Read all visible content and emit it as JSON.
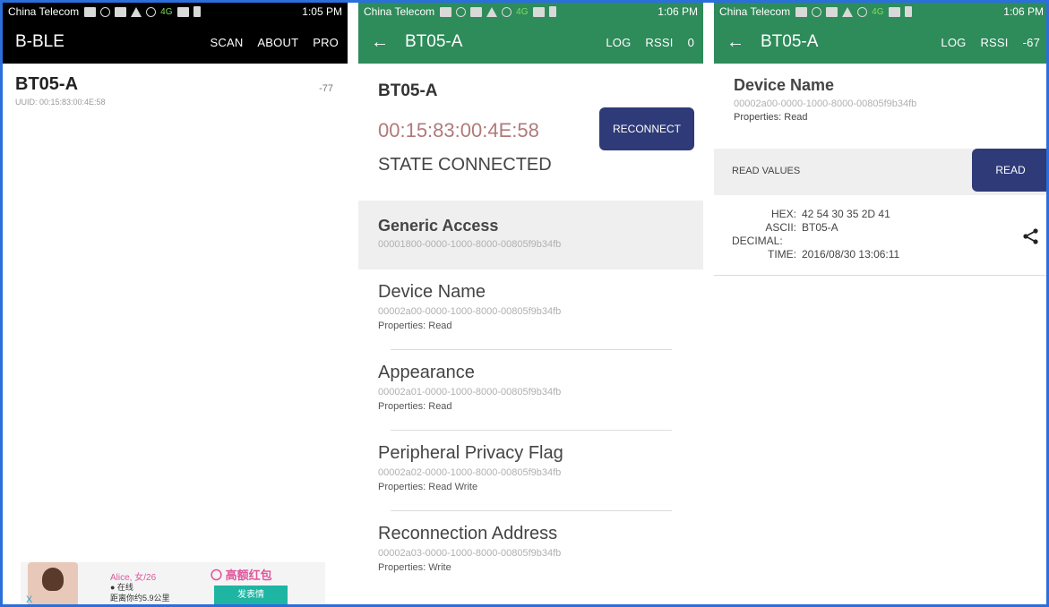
{
  "status_bar": {
    "carrier": "China Telecom",
    "signal_label": "4G",
    "time_1": "1:05 PM",
    "time_2": "1:06 PM",
    "time_3": "1:06 PM"
  },
  "scan_screen": {
    "app_title": "B-BLE",
    "actions": [
      "SCAN",
      "ABOUT",
      "PRO"
    ],
    "device": {
      "name": "BT05-A",
      "uuid": "UUID: 00:15:83:00:4E:58",
      "rssi": "-77"
    },
    "ad": {
      "close": "X",
      "line1": "Alice, 女/26",
      "line2": "● 在线",
      "line3": "距离你约5.9公里",
      "logo": "〇 高额红包",
      "button": "发表情"
    }
  },
  "device_screen": {
    "title": "BT05-A",
    "actions": {
      "log": "LOG",
      "rssi": "RSSI",
      "rssi_value": "0"
    },
    "name": "BT05-A",
    "mac": "00:15:83:00:4E:58",
    "state": "STATE CONNECTED",
    "reconnect_label": "RECONNECT",
    "service": {
      "name": "Generic Access",
      "uuid": "00001800-0000-1000-8000-00805f9b34fb"
    },
    "characteristics": [
      {
        "name": "Device Name",
        "uuid": "00002a00-0000-1000-8000-00805f9b34fb",
        "props": "Properties: Read"
      },
      {
        "name": "Appearance",
        "uuid": "00002a01-0000-1000-8000-00805f9b34fb",
        "props": "Properties: Read"
      },
      {
        "name": "Peripheral Privacy Flag",
        "uuid": "00002a02-0000-1000-8000-00805f9b34fb",
        "props": "Properties: Read Write"
      },
      {
        "name": "Reconnection Address",
        "uuid": "00002a03-0000-1000-8000-00805f9b34fb",
        "props": "Properties: Write"
      }
    ]
  },
  "char_screen": {
    "title": "BT05-A",
    "actions": {
      "log": "LOG",
      "rssi": "RSSI",
      "rssi_value": "-67"
    },
    "name": "Device Name",
    "uuid": "00002a00-0000-1000-8000-00805f9b34fb",
    "props": "Properties: Read",
    "read_values_label": "READ VALUES",
    "read_button": "READ",
    "values": {
      "hex_key": "HEX:",
      "hex": "42 54 30 35 2D 41",
      "ascii_key": "ASCII:",
      "ascii": "BT05-A",
      "decimal_key": "DECIMAL:",
      "decimal": "",
      "time_key": "TIME:",
      "time": "2016/08/30 13:06:11"
    },
    "share_icon": "share-icon"
  }
}
